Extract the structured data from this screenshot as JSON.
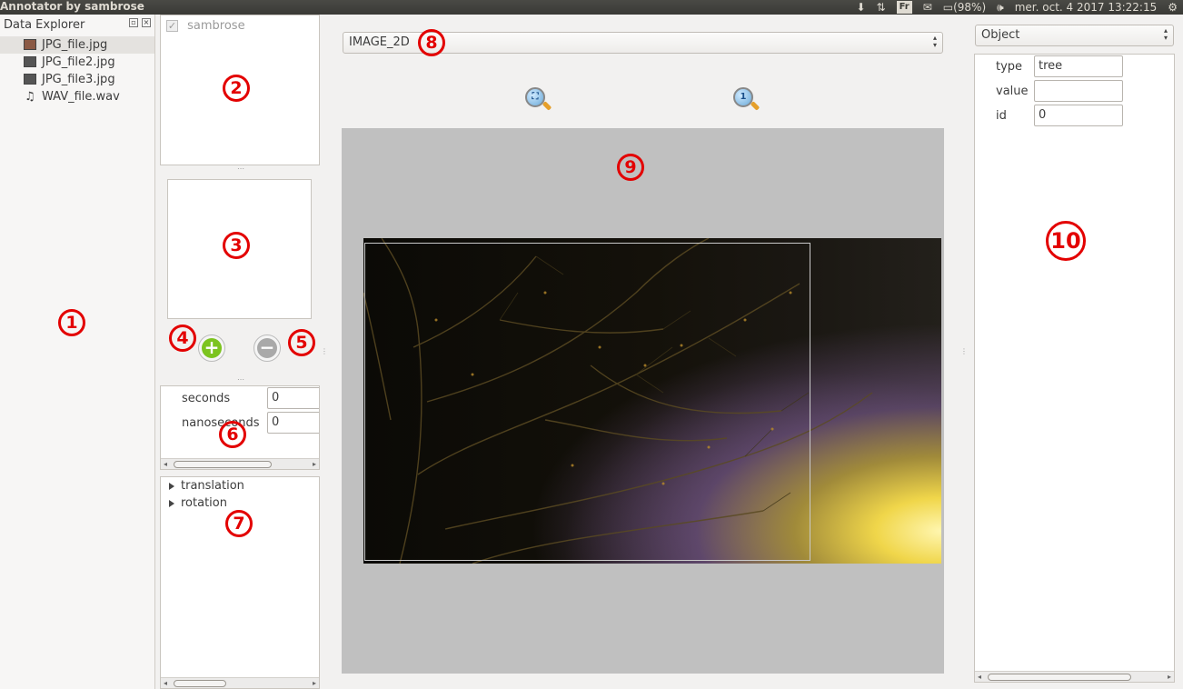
{
  "window": {
    "title": "Annotator by sambrose"
  },
  "tray": {
    "lang": "Fr",
    "battery": "(98%)",
    "clock": "mer. oct.  4 2017 13:22:15"
  },
  "explorer": {
    "title": "Data Explorer",
    "files": [
      {
        "name": "JPG_file.jpg",
        "kind": "image"
      },
      {
        "name": "JPG_file2.jpg",
        "kind": "image"
      },
      {
        "name": "JPG_file3.jpg",
        "kind": "image"
      },
      {
        "name": "WAV_file.wav",
        "kind": "audio"
      }
    ]
  },
  "users": {
    "items": [
      {
        "label": "sambrose",
        "checked": true
      }
    ]
  },
  "time": {
    "seconds_label": "seconds",
    "seconds_value": "0",
    "nanoseconds_label": "nanoseconds",
    "nanoseconds_value": "0"
  },
  "transform": {
    "items": [
      "translation",
      "rotation"
    ]
  },
  "view": {
    "type_selected": "IMAGE_2D",
    "zoom_fit_label": "",
    "zoom_one_label": "1"
  },
  "object": {
    "selector": "Object",
    "fields": [
      {
        "label": "type",
        "value": "tree"
      },
      {
        "label": "value",
        "value": ""
      },
      {
        "label": "id",
        "value": "0"
      }
    ]
  },
  "callouts": [
    "1",
    "2",
    "3",
    "4",
    "5",
    "6",
    "7",
    "8",
    "9",
    "10"
  ],
  "colors": {
    "callout": "#e30000",
    "add": "#7cc41f",
    "remove": "#a9a9a9",
    "canvas": "#c0c0c0"
  }
}
